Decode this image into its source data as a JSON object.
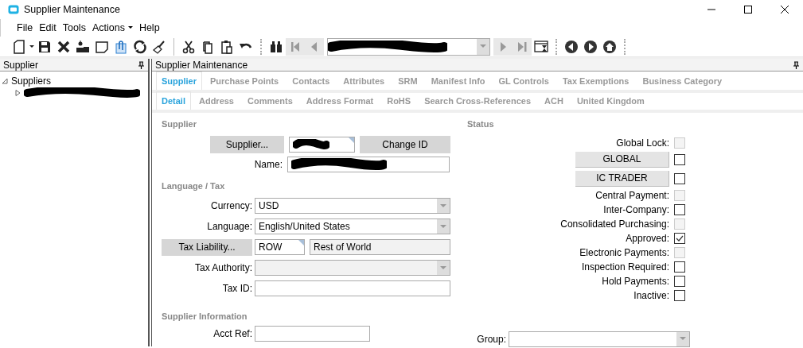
{
  "window": {
    "title": "Supplier Maintenance"
  },
  "menu": [
    {
      "label": "File",
      "dropdown": false
    },
    {
      "label": "Edit",
      "dropdown": false
    },
    {
      "label": "Tools",
      "dropdown": false
    },
    {
      "label": "Actions",
      "dropdown": true
    },
    {
      "label": "Help",
      "dropdown": false
    }
  ],
  "record_selector": {
    "redacted": true
  },
  "left_panel": {
    "title": "Supplier",
    "tree": [
      {
        "label": "Suppliers",
        "expanded": true,
        "children": [
          {
            "redacted": true,
            "expanded": false
          }
        ]
      }
    ]
  },
  "main_panel": {
    "title": "Supplier Maintenance",
    "tabs": [
      {
        "label": "Supplier",
        "selected": true
      },
      {
        "label": "Purchase Points",
        "selected": false
      },
      {
        "label": "Contacts",
        "selected": false
      },
      {
        "label": "Attributes",
        "selected": false
      },
      {
        "label": "SRM",
        "selected": false
      },
      {
        "label": "Manifest Info",
        "selected": false
      },
      {
        "label": "GL Controls",
        "selected": false
      },
      {
        "label": "Tax Exemptions",
        "selected": false
      },
      {
        "label": "Business Category",
        "selected": false
      }
    ],
    "subtabs": [
      {
        "label": "Detail",
        "selected": true
      },
      {
        "label": "Address",
        "selected": false
      },
      {
        "label": "Comments",
        "selected": false
      },
      {
        "label": "Address Format",
        "selected": false
      },
      {
        "label": "RoHS",
        "selected": false
      },
      {
        "label": "Search Cross-References",
        "selected": false
      },
      {
        "label": "ACH",
        "selected": false
      },
      {
        "label": "United Kingdom",
        "selected": false
      }
    ],
    "supplier": {
      "title": "Supplier",
      "lookup_button": "Supplier...",
      "id_redacted": true,
      "change_button": "Change ID",
      "name_label": "Name:",
      "name_redacted": true
    },
    "language_tax": {
      "title": "Language / Tax",
      "fields": [
        {
          "kind": "combo",
          "label": "Currency:",
          "value": "USD",
          "disabled": false
        },
        {
          "kind": "combo",
          "label": "Language:",
          "value": "English/United States",
          "disabled": false
        },
        {
          "kind": "lookup",
          "label": "Tax Liability...",
          "value": "ROW",
          "description": "Rest of World",
          "disabled": false
        },
        {
          "kind": "combo",
          "label": "Tax Authority:",
          "disabled": true
        },
        {
          "kind": "text",
          "label": "Tax ID:",
          "disabled": false
        }
      ]
    },
    "supplier_information": {
      "title": "Supplier Information",
      "fields": [
        {
          "kind": "text",
          "label": "Acct Ref:"
        }
      ]
    },
    "status": {
      "title": "Status",
      "items": [
        {
          "kind": "check",
          "label": "Global Lock:",
          "checked": false,
          "disabled": true
        },
        {
          "kind": "button",
          "label": "GLOBAL",
          "checked": false,
          "disabled": false
        },
        {
          "kind": "button",
          "label": "IC TRADER",
          "checked": false,
          "disabled": false
        },
        {
          "kind": "check",
          "label": "Central Payment:",
          "checked": false,
          "disabled": true
        },
        {
          "kind": "check",
          "label": "Inter-Company:",
          "checked": false,
          "disabled": false
        },
        {
          "kind": "check",
          "label": "Consolidated Purchasing:",
          "checked": false,
          "disabled": true
        },
        {
          "kind": "check",
          "label": "Approved:",
          "checked": true,
          "disabled": false
        },
        {
          "kind": "check",
          "label": "Electronic Payments:",
          "checked": false,
          "disabled": true
        },
        {
          "kind": "check",
          "label": "Inspection Required:",
          "checked": false,
          "disabled": false
        },
        {
          "kind": "check",
          "label": "Hold Payments:",
          "checked": false,
          "disabled": false
        },
        {
          "kind": "check",
          "label": "Inactive:",
          "checked": false,
          "disabled": false
        }
      ]
    },
    "group": {
      "label": "Group:"
    }
  }
}
